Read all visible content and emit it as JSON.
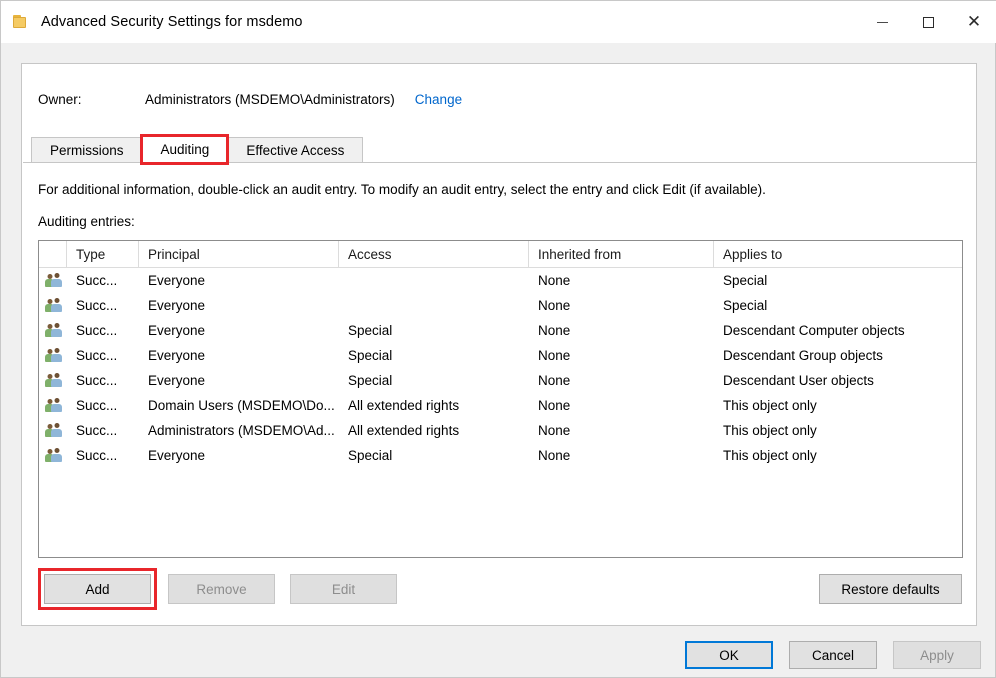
{
  "window": {
    "title": "Advanced Security Settings for msdemo",
    "icon": "folder-icon",
    "minimize_label": "Minimize",
    "maximize_label": "Maximize",
    "close_label": "Close"
  },
  "owner": {
    "label": "Owner:",
    "value": "Administrators (MSDEMO\\Administrators)",
    "change_link": "Change"
  },
  "tabs": [
    {
      "label": "Permissions",
      "active": false,
      "highlighted": false
    },
    {
      "label": "Auditing",
      "active": true,
      "highlighted": true
    },
    {
      "label": "Effective Access",
      "active": false,
      "highlighted": false
    }
  ],
  "body": {
    "info_text": "For additional information, double-click an audit entry. To modify an audit entry, select the entry and click Edit (if available).",
    "entries_label": "Auditing entries:"
  },
  "grid": {
    "columns": [
      "",
      "Type",
      "Principal",
      "Access",
      "Inherited from",
      "Applies to"
    ],
    "rows": [
      {
        "icon": "users-icon",
        "type": "Succ...",
        "principal": "Everyone",
        "access": "",
        "inherited": "None",
        "applies": "Special"
      },
      {
        "icon": "users-icon",
        "type": "Succ...",
        "principal": "Everyone",
        "access": "",
        "inherited": "None",
        "applies": "Special"
      },
      {
        "icon": "users-icon",
        "type": "Succ...",
        "principal": "Everyone",
        "access": "Special",
        "inherited": "None",
        "applies": "Descendant Computer objects"
      },
      {
        "icon": "users-icon",
        "type": "Succ...",
        "principal": "Everyone",
        "access": "Special",
        "inherited": "None",
        "applies": "Descendant Group objects"
      },
      {
        "icon": "users-icon",
        "type": "Succ...",
        "principal": "Everyone",
        "access": "Special",
        "inherited": "None",
        "applies": "Descendant User objects"
      },
      {
        "icon": "users-icon",
        "type": "Succ...",
        "principal": "Domain Users (MSDEMO\\Do...",
        "access": "All extended rights",
        "inherited": "None",
        "applies": "This object only"
      },
      {
        "icon": "users-icon",
        "type": "Succ...",
        "principal": "Administrators (MSDEMO\\Ad...",
        "access": "All extended rights",
        "inherited": "None",
        "applies": "This object only"
      },
      {
        "icon": "users-icon",
        "type": "Succ...",
        "principal": "Everyone",
        "access": "Special",
        "inherited": "None",
        "applies": "This object only"
      }
    ]
  },
  "actions": {
    "add": "Add",
    "remove": "Remove",
    "edit": "Edit",
    "restore_defaults": "Restore defaults"
  },
  "footer": {
    "ok": "OK",
    "cancel": "Cancel",
    "apply": "Apply"
  },
  "highlights": {
    "color": "#e8262b",
    "targets": [
      "tab-auditing",
      "add-button"
    ]
  }
}
